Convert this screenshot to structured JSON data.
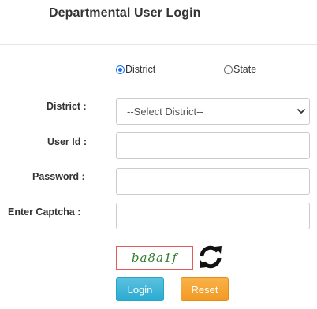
{
  "header": {
    "title": "Departmental User Login"
  },
  "login_type": {
    "options": [
      {
        "label": "District",
        "selected": true
      },
      {
        "label": "State",
        "selected": false
      }
    ]
  },
  "form": {
    "district_label": "District :",
    "district_select_value": "--Select District--",
    "userid_label": "User Id :",
    "userid_value": "",
    "password_label": "Password :",
    "password_value": "",
    "captcha_label": "Enter Captcha :",
    "captcha_value": ""
  },
  "captcha": {
    "code": "ba8a1f",
    "refresh_icon": "refresh-icon"
  },
  "buttons": {
    "login_label": "Login",
    "reset_label": "Reset"
  },
  "colors": {
    "login_button": "#31b0d5",
    "reset_button": "#f0ad4e",
    "captcha_border": "#e35b5b",
    "captcha_text": "#2f7d2f",
    "radio_accent": "#1a73e8"
  }
}
